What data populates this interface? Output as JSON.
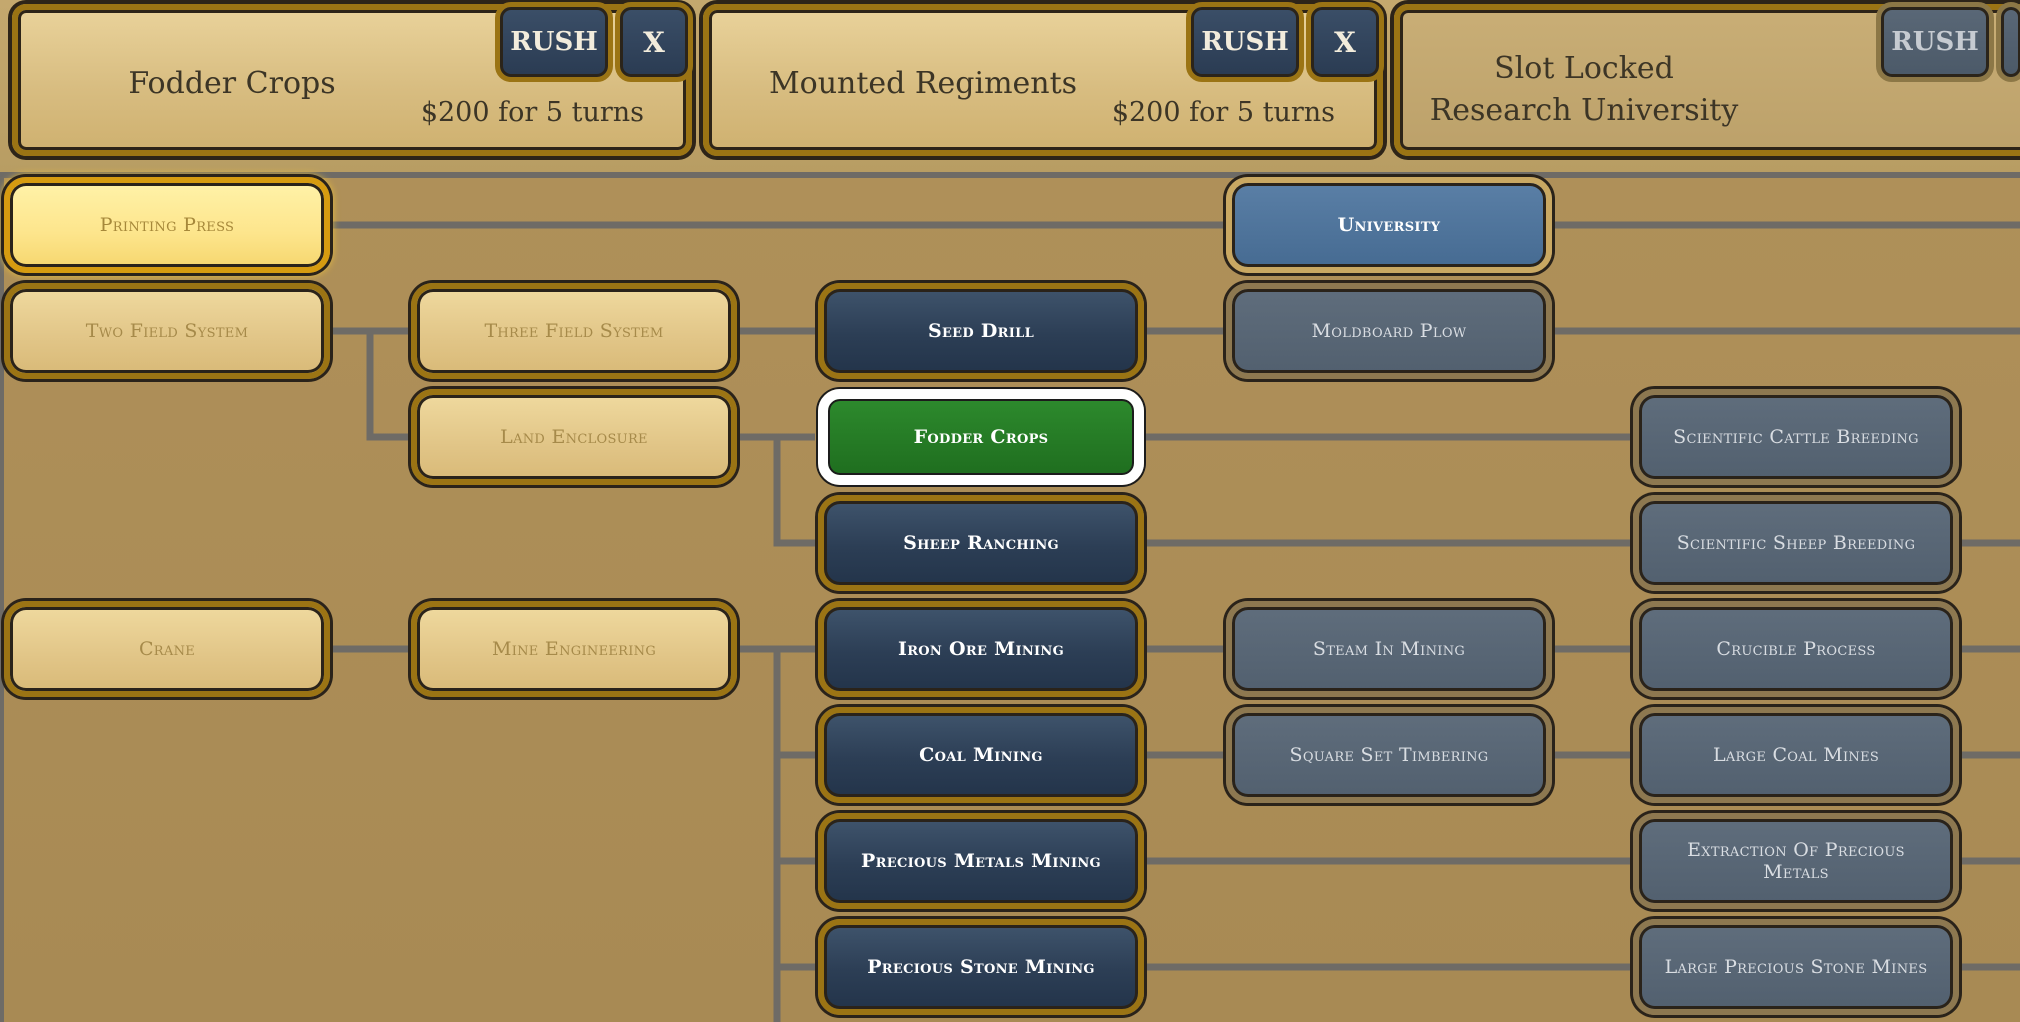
{
  "queue": [
    {
      "title": "Fodder Crops",
      "cost": "$200 for 5 turns",
      "rush_label": "RUSH",
      "close_label": "X"
    },
    {
      "title": "Mounted Regiments",
      "cost": "$200 for 5 turns",
      "rush_label": "RUSH",
      "close_label": "X"
    },
    {
      "line1": "Slot Locked",
      "line2": "Research University",
      "rush_label": "RUSH"
    }
  ],
  "tree": {
    "printing_press": "Printing Press",
    "university": "University",
    "two_field_system": "Two Field System",
    "three_field_system": "Three Field System",
    "seed_drill": "Seed Drill",
    "moldboard_plow": "Moldboard Plow",
    "land_enclosure": "Land Enclosure",
    "fodder_crops": "Fodder Crops",
    "scientific_cattle_breeding": "Scientific Cattle Breeding",
    "sheep_ranching": "Sheep Ranching",
    "scientific_sheep_breeding": "Scientific Sheep Breeding",
    "crane": "Crane",
    "mine_engineering": "Mine Engineering",
    "iron_ore_mining": "Iron Ore Mining",
    "steam_in_mining": "Steam In Mining",
    "crucible_process": "Crucible Process",
    "coal_mining": "Coal Mining",
    "square_set_timbering": "Square Set Timbering",
    "large_coal_mines": "Large Coal Mines",
    "precious_metals_mining": "Precious Metals Mining",
    "extraction_of_precious_metals": "Extraction Of Precious Metals",
    "precious_stone_mining": "Precious Stone Mining",
    "large_precious_stone_mines": "Large Precious Stone Mines"
  }
}
